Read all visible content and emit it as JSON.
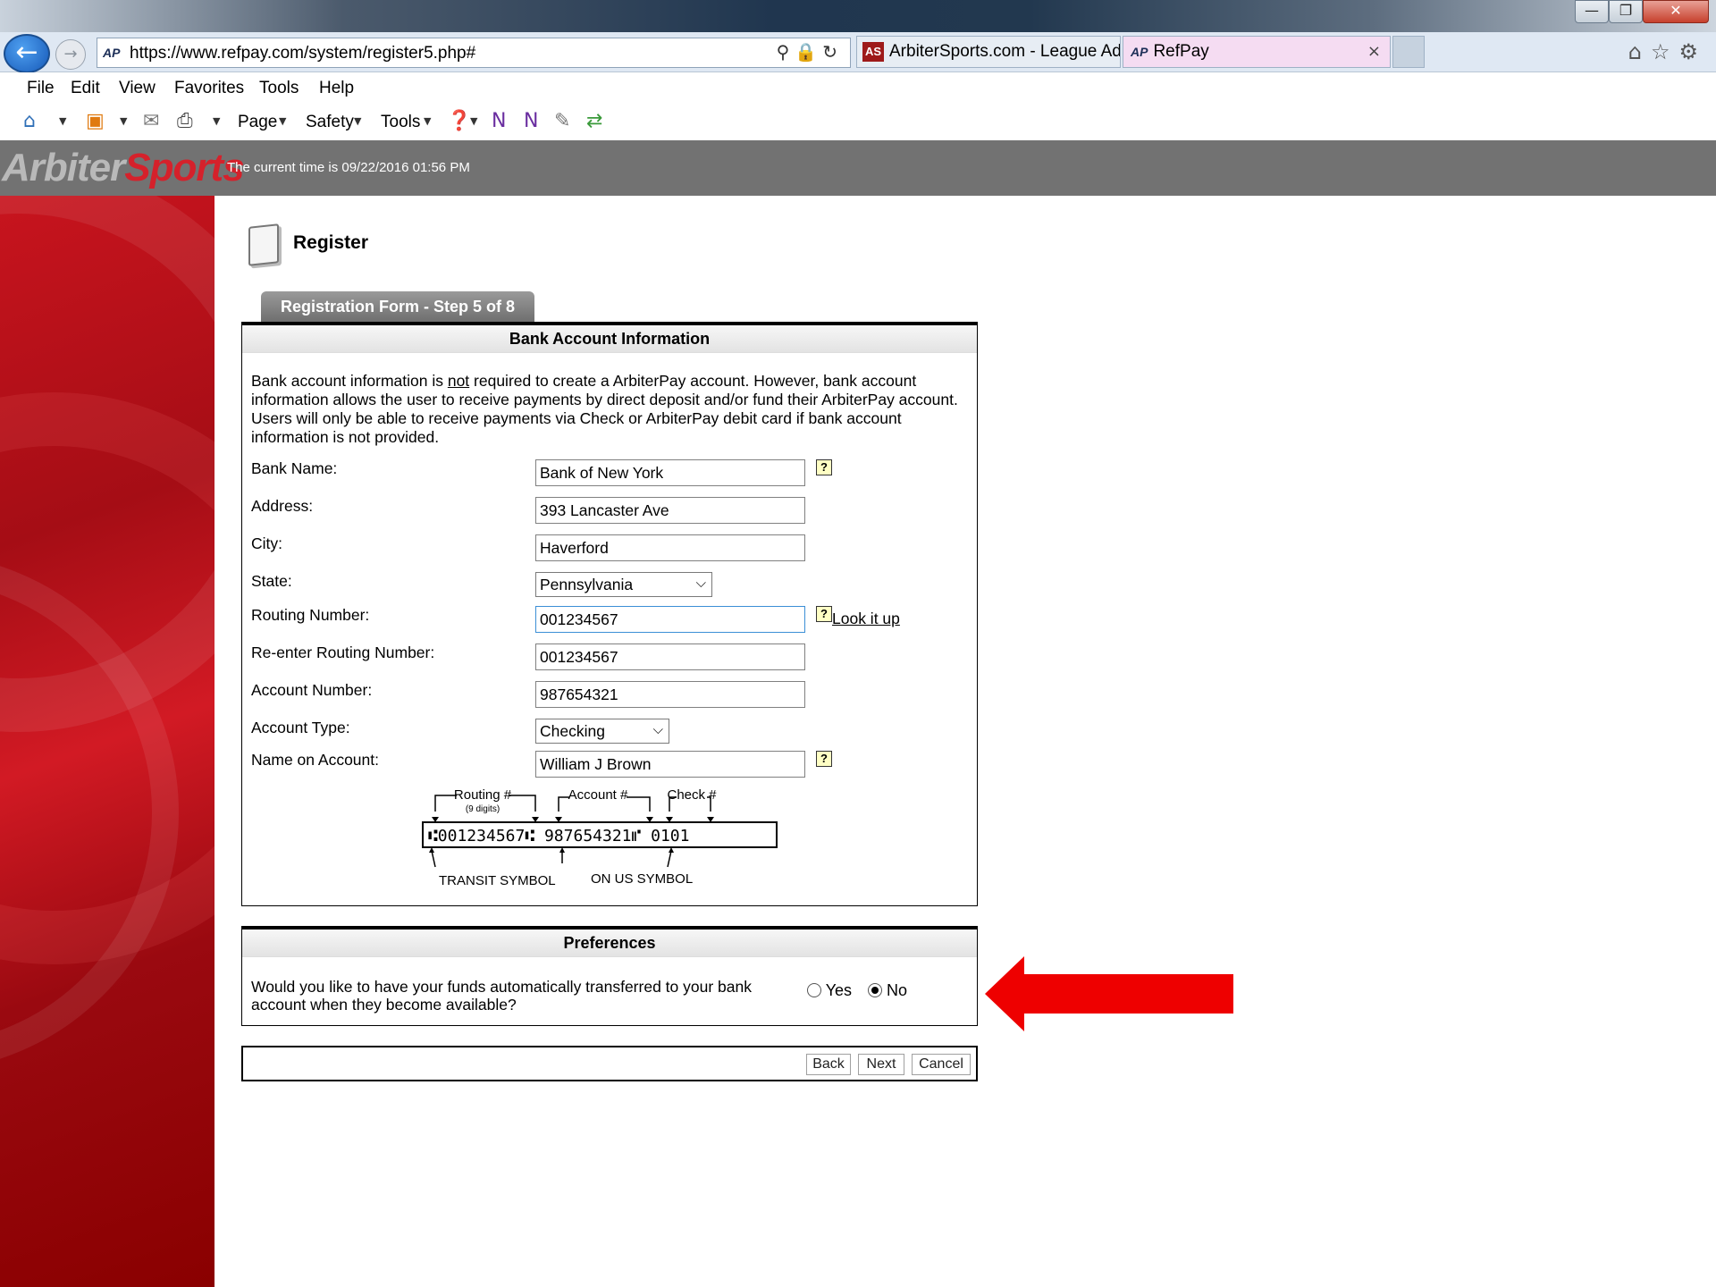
{
  "window": {
    "minimize": "—",
    "maximize": "❐",
    "close": "✕"
  },
  "browser": {
    "url": "https://www.refpay.com/system/register5.php#",
    "tabs": [
      {
        "label": "ArbiterSports.com - League Ad...",
        "icon": "AS"
      },
      {
        "label": "RefPay",
        "icon": "AP"
      }
    ],
    "tab_close": "×",
    "favicon": "AP",
    "menu": [
      "File",
      "Edit",
      "View",
      "Favorites",
      "Tools",
      "Help"
    ],
    "command_bar": {
      "page": "Page",
      "safety": "Safety",
      "tools": "Tools"
    }
  },
  "site": {
    "logo_part1": "Arbiter",
    "logo_part2": "Sports",
    "current_time": "The current time is 09/22/2016 01:56 PM"
  },
  "page": {
    "title": "Register",
    "step_tab": "Registration Form - Step 5 of 8"
  },
  "bank_section": {
    "header": "Bank Account Information",
    "intro_pre": "Bank account information is ",
    "intro_not": "not",
    "intro_post": " required to create a ArbiterPay account. However, bank account information allows the user to receive payments by direct deposit and/or fund their ArbiterPay account. Users will only be able to receive payments via Check or ArbiterPay debit card if bank account information is not provided.",
    "fields": {
      "bank_name": {
        "label": "Bank Name:",
        "value": "Bank of New York"
      },
      "address": {
        "label": "Address:",
        "value": "393 Lancaster Ave"
      },
      "city": {
        "label": "City:",
        "value": "Haverford"
      },
      "state": {
        "label": "State:",
        "value": "Pennsylvania"
      },
      "routing": {
        "label": "Routing Number:",
        "value": "001234567"
      },
      "routing_confirm": {
        "label": "Re-enter Routing Number:",
        "value": "001234567"
      },
      "account_number": {
        "label": "Account Number:",
        "value": "987654321"
      },
      "account_type": {
        "label": "Account Type:",
        "value": "Checking"
      },
      "name_on_account": {
        "label": "Name on Account:",
        "value": "William J Brown"
      }
    },
    "help_glyph": "?",
    "lookup_link": "Look it up",
    "check_diagram": {
      "routing_label": "Routing #",
      "routing_sub": "(9 digits)",
      "account_label": "Account #",
      "check_label": "Check #",
      "micr_line": "⑆001234567⑆  987654321⑈  0101",
      "transit_symbol": "TRANSIT SYMBOL",
      "on_us_symbol": "ON US SYMBOL"
    }
  },
  "preferences": {
    "header": "Preferences",
    "question": "Would you like to have your funds automatically transferred to your bank account when they become available?",
    "options": [
      {
        "label": "Yes",
        "selected": false
      },
      {
        "label": "No",
        "selected": true
      }
    ]
  },
  "buttons": {
    "back": "Back",
    "next": "Next",
    "cancel": "Cancel"
  },
  "colors": {
    "header_gray": "#727272",
    "panel_red": "#8a0000",
    "annotation_arrow": "#ee0000"
  }
}
